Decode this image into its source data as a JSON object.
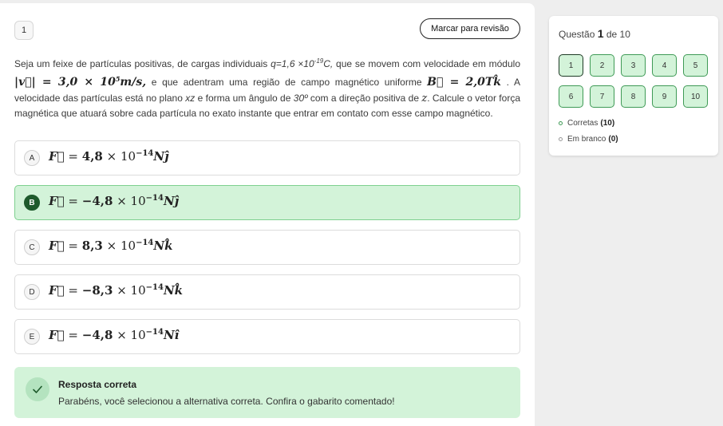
{
  "question": {
    "number": "1",
    "review_button": "Marcar para revisão",
    "statement": {
      "p1": "Seja um feixe de partículas positivas, de cargas individuais ",
      "charge": "q=1,6 ×10",
      "charge_exp": "-19",
      "charge_unit": "C,",
      "p2": "  que se movem com velocidade em módulo ",
      "velocity": "|v⃗| = 3,0 × 10",
      "velocity_exp": "5",
      "velocity_unit": "m/s,",
      "p3": "  e que adentram uma região de campo magnético uniforme ",
      "field": "B⃗ = 2,0Tk̂",
      "p4": " . A velocidade das partículas está no plano ",
      "plane": "xz",
      "p5": "  e forma um ângulo de ",
      "angle": "30º",
      "p6": "  com a direção positiva de ",
      "axis": "z",
      "p7": ". Calcule o vetor força magnética que atuará sobre cada partícula no exato instante que entrar em contato com esse campo magnético."
    }
  },
  "options": [
    {
      "letter": "A",
      "lhs": "F⃗",
      "eq": " = ",
      "mantissa": "4,8",
      "times": " × 10",
      "exp": "−14",
      "unit": "Nĵ"
    },
    {
      "letter": "B",
      "lhs": "F⃗",
      "eq": " = ",
      "mantissa": "−4,8",
      "times": " × 10",
      "exp": "−14",
      "unit": "Nĵ"
    },
    {
      "letter": "C",
      "lhs": "F⃗",
      "eq": " = ",
      "mantissa": "8,3",
      "times": " × 10",
      "exp": "−14",
      "unit": "Nk̂"
    },
    {
      "letter": "D",
      "lhs": "F⃗",
      "eq": " = ",
      "mantissa": "−8,3",
      "times": " × 10",
      "exp": "−14",
      "unit": "Nk̂"
    },
    {
      "letter": "E",
      "lhs": "F⃗",
      "eq": " = ",
      "mantissa": "−4,8",
      "times": " × 10",
      "exp": "−14",
      "unit": "Nî"
    }
  ],
  "selected_option": "B",
  "feedback": {
    "title": "Resposta correta",
    "text": "Parabéns, você selecionou a alternativa correta. Confira o gabarito comentado!"
  },
  "navigator": {
    "label": "Questão",
    "current": "1",
    "of": "de 10",
    "questions": [
      "1",
      "2",
      "3",
      "4",
      "5",
      "6",
      "7",
      "8",
      "9",
      "10"
    ],
    "legend": {
      "correct_label": "Corretas",
      "correct_count": "(10)",
      "blank_label": "Em branco",
      "blank_count": "(0)"
    }
  },
  "colors": {
    "correct_green": "#d3f3d9",
    "selected_dark_green": "#1e5a2c",
    "nav_border_green": "#3f9a56"
  }
}
